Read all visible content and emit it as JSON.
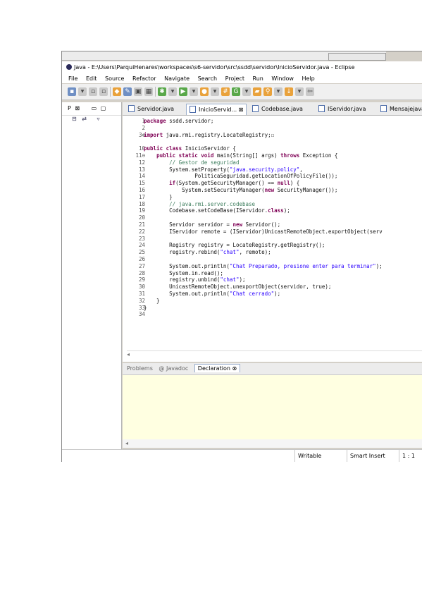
{
  "window": {
    "title": "Java - E:\\Users\\ParquiHenares\\workspaces\\s6-servidor\\src\\ssdd\\servidor\\InicioServidor.java - Eclipse"
  },
  "menu": [
    "File",
    "Edit",
    "Source",
    "Refactor",
    "Navigate",
    "Search",
    "Project",
    "Run",
    "Window",
    "Help"
  ],
  "left_panel": {
    "tab_label": "P",
    "close": "⊠",
    "min": "▭",
    "max": "▢"
  },
  "editor_tabs": [
    {
      "label": "Servidor.java",
      "active": false
    },
    {
      "label": "InicioServid...",
      "active": true
    },
    {
      "label": "Codebase.java",
      "active": false
    },
    {
      "label": "IServidor.java",
      "active": false
    },
    {
      "label": "Mensajejava",
      "active": false
    }
  ],
  "code_lines": [
    {
      "n": "1",
      "text": "package ssdd.servidor;"
    },
    {
      "n": "2",
      "text": ""
    },
    {
      "n": "3⊕",
      "text": "import java.rmi.registry.LocateRegistry;☐"
    },
    {
      "n": "",
      "text": ""
    },
    {
      "n": "10",
      "text": "public class InicioServidor {"
    },
    {
      "n": "11⊖",
      "text": "    public static void main(String[] args) throws Exception {"
    },
    {
      "n": "12",
      "text": "        // Gestor de seguridad"
    },
    {
      "n": "13",
      "text": "        System.setProperty(\"java.security.policy\","
    },
    {
      "n": "14",
      "text": "                PoliticaSeguridad.getLocationOfPolicyFile());"
    },
    {
      "n": "15",
      "text": "        if(System.getSecurityManager() == null) {"
    },
    {
      "n": "16",
      "text": "            System.setSecurityManager(new SecurityManager());"
    },
    {
      "n": "17",
      "text": "        }"
    },
    {
      "n": "18",
      "text": "        // java.rmi.server.codebase"
    },
    {
      "n": "19",
      "text": "        Codebase.setCodeBase(IServidor.class);"
    },
    {
      "n": "20",
      "text": ""
    },
    {
      "n": "21",
      "text": "        Servidor servidor = new Servidor();"
    },
    {
      "n": "22",
      "text": "        IServidor remote = (IServidor)UnicastRemoteObject.exportObject(serv"
    },
    {
      "n": "23",
      "text": ""
    },
    {
      "n": "24",
      "text": "        Registry registry = LocateRegistry.getRegistry();"
    },
    {
      "n": "25",
      "text": "        registry.rebind(\"chat\", remote);"
    },
    {
      "n": "26",
      "text": ""
    },
    {
      "n": "27",
      "text": "        System.out.println(\"Chat Preparado, presione enter para terminar\");"
    },
    {
      "n": "28",
      "text": "        System.in.read();"
    },
    {
      "n": "29",
      "text": "        registry.unbind(\"chat\");"
    },
    {
      "n": "30",
      "text": "        UnicastRemoteObject.unexportObject(servidor, true);"
    },
    {
      "n": "31",
      "text": "        System.out.println(\"Chat cerrado\");"
    },
    {
      "n": "32",
      "text": "    }"
    },
    {
      "n": "33",
      "text": "}"
    },
    {
      "n": "34",
      "text": ""
    }
  ],
  "bottom_tabs": [
    {
      "label": "Problems",
      "active": false
    },
    {
      "label": "@ Javadoc",
      "active": false
    },
    {
      "label": "Declaration ⊗",
      "active": true
    }
  ],
  "status": {
    "writable": "Writable",
    "insert": "Smart Insert",
    "position": "1 : 1"
  }
}
